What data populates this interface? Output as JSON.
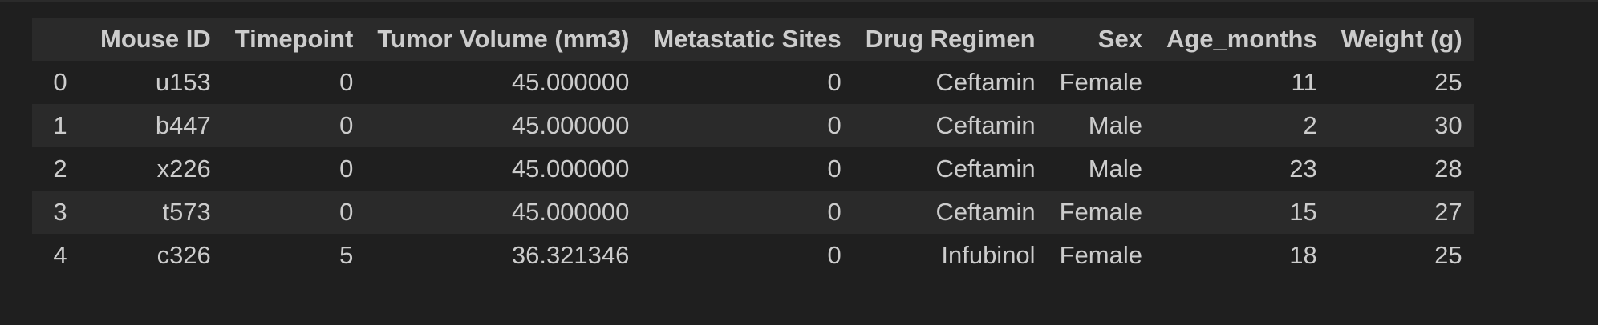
{
  "table": {
    "columns": [
      "",
      "Mouse ID",
      "Timepoint",
      "Tumor Volume (mm3)",
      "Metastatic Sites",
      "Drug Regimen",
      "Sex",
      "Age_months",
      "Weight (g)"
    ],
    "rows": [
      [
        "0",
        "u153",
        "0",
        "45.000000",
        "0",
        "Ceftamin",
        "Female",
        "11",
        "25"
      ],
      [
        "1",
        "b447",
        "0",
        "45.000000",
        "0",
        "Ceftamin",
        "Male",
        "2",
        "30"
      ],
      [
        "2",
        "x226",
        "0",
        "45.000000",
        "0",
        "Ceftamin",
        "Male",
        "23",
        "28"
      ],
      [
        "3",
        "t573",
        "0",
        "45.000000",
        "0",
        "Ceftamin",
        "Female",
        "15",
        "27"
      ],
      [
        "4",
        "c326",
        "5",
        "36.321346",
        "0",
        "Infubinol",
        "Female",
        "18",
        "25"
      ]
    ]
  }
}
